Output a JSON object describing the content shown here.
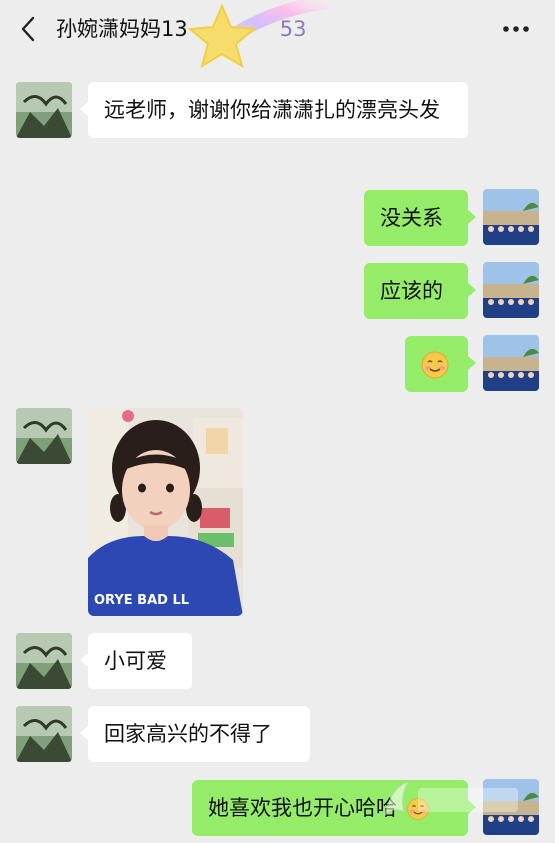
{
  "header": {
    "title": "孙婉潇妈妈13",
    "title_tail": "53"
  },
  "messages": [
    {
      "side": "in",
      "text": "远老师，谢谢你给潇潇扎的漂亮头发"
    },
    {
      "side": "out",
      "text": "没关系"
    },
    {
      "side": "out",
      "text": "应该的"
    },
    {
      "side": "out",
      "emoji": "smile-emoji"
    },
    {
      "side": "in",
      "image": "child-photo",
      "shirt_text": "ORYE BAD LL"
    },
    {
      "side": "in",
      "text": "小可爱"
    },
    {
      "side": "in",
      "text": "回家高兴的不得了"
    },
    {
      "side": "out",
      "text": "她喜欢我也开心哈哈"
    }
  ],
  "colors": {
    "background": "#ededed",
    "incoming_bubble": "#ffffff",
    "outgoing_bubble": "#95ec69"
  },
  "icons": [
    "back-arrow-icon",
    "more-dots-icon",
    "star-sticker-icon",
    "smile-emoji-icon",
    "watermark-logo"
  ]
}
